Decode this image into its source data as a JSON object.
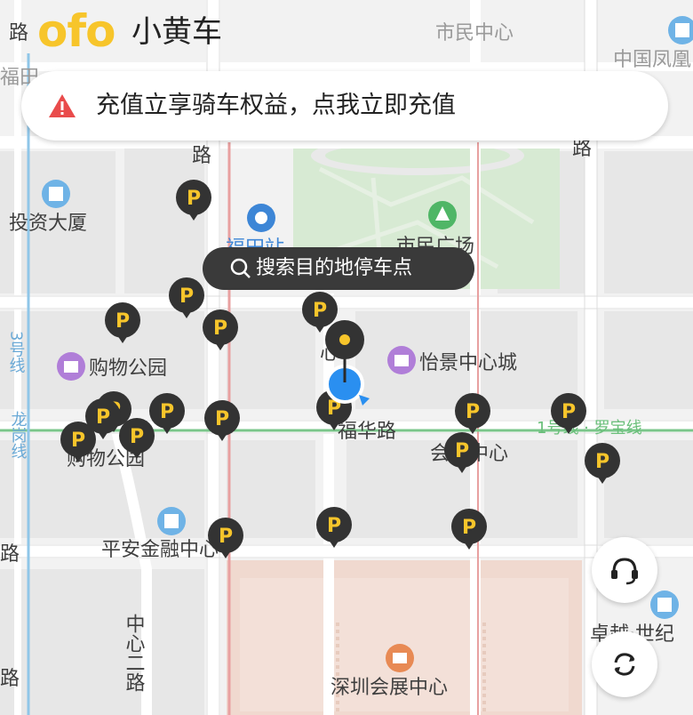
{
  "app": {
    "logo_text": "ofo",
    "logo_cn": "小黄车",
    "accent_color": "#f7c52b"
  },
  "banner": {
    "icon": "warning-icon",
    "message": "充值立享骑车权益，点我立即充值"
  },
  "search": {
    "icon": "search-icon",
    "label": "搜索目的地停车点"
  },
  "buttons": {
    "customer_service_icon": "headset-icon",
    "refresh_icon": "refresh-icon"
  },
  "map": {
    "labels": [
      {
        "id": "lbl-road-tl",
        "text": "路"
      },
      {
        "id": "lbl-shiminzhongxin",
        "text": "市民中心"
      },
      {
        "id": "lbl-futian-edge",
        "text": "福田"
      },
      {
        "id": "lbl-zhongguofenghuang",
        "text": "中国凤凰"
      },
      {
        "id": "lbl-road-1",
        "text": "路"
      },
      {
        "id": "lbl-road-2",
        "text": "路"
      },
      {
        "id": "lbl-touzidasha",
        "text": "投资大厦"
      },
      {
        "id": "lbl-futianzhan",
        "text": "福田站"
      },
      {
        "id": "lbl-shiminguangchang",
        "text": "市民广场"
      },
      {
        "id": "lbl-gouwugongyuan",
        "text": "购物公园"
      },
      {
        "id": "lbl-yijingzhongxincheng",
        "text": "怡景中心城"
      },
      {
        "id": "lbl-fuhualu",
        "text": "福华路"
      },
      {
        "id": "lbl-huizhanzhongxin",
        "text": "会展中心"
      },
      {
        "id": "lbl-gouwugongyuan2",
        "text": "购物公园"
      },
      {
        "id": "lbl-pinganjinrong",
        "text": "平安金融中心"
      },
      {
        "id": "lbl-road-left",
        "text": "路"
      },
      {
        "id": "lbl-road-left2",
        "text": "路"
      },
      {
        "id": "lbl-zhongxinerlu",
        "text": "中心二路"
      },
      {
        "id": "lbl-zhuoyue",
        "text": "卓越·世纪"
      },
      {
        "id": "lbl-shenzhenhuizhan",
        "text": "深圳会展中心"
      },
      {
        "id": "lbl-line3",
        "text": "3号线"
      },
      {
        "id": "lbl-longgangxian",
        "text": "龙岗线"
      },
      {
        "id": "lbl-line1",
        "text": "1号线 · 罗宝线"
      },
      {
        "id": "lbl-zhongxin",
        "text": "心"
      }
    ],
    "parking_marker_letter": "P",
    "parking_count": 23
  }
}
